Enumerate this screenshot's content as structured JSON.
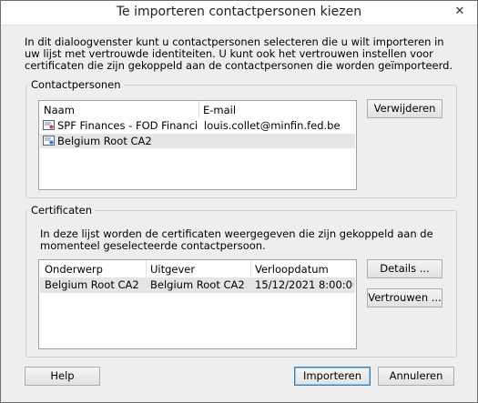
{
  "window": {
    "title": "Te importeren contactpersonen kiezen",
    "close_glyph": "✕"
  },
  "intro": "In dit dialoogvenster kunt u contactpersonen selecteren die u wilt importeren in uw lijst met vertrouwde identiteiten. U kunt ook het vertrouwen instellen voor certificaten die zijn gekoppeld aan de contactpersonen die worden geïmporteerd.",
  "contacts": {
    "legend": "Contactpersonen",
    "columns": [
      "Naam",
      "E-mail"
    ],
    "rows": [
      {
        "name": "SPF Finances - FOD Financien <lo...",
        "email": "louis.collet@minfin.fed.be",
        "icon": "certificate-icon"
      },
      {
        "name": "Belgium Root CA2",
        "email": "",
        "icon": "certificate-icon"
      }
    ],
    "remove_label": "Verwijderen"
  },
  "certs": {
    "legend": "Certificaten",
    "description": "In deze lijst worden de certificaten weergegeven die zijn gekoppeld aan de momenteel geselecteerde contactpersoon.",
    "columns": [
      "Onderwerp",
      "Uitgever",
      "Verloopdatum"
    ],
    "rows": [
      {
        "subject": "Belgium Root CA2",
        "issuer": "Belgium Root CA2",
        "expires": "15/12/2021 8:00:00"
      }
    ],
    "details_label": "Details ...",
    "trust_label": "Vertrouwen ..."
  },
  "footer": {
    "help_label": "Help",
    "import_label": "Importeren",
    "cancel_label": "Annuleren"
  },
  "colors": {
    "dialog_bg": "#eeeeee",
    "selected_row": "#e5e5e5",
    "default_button_border": "#3c7fb1"
  }
}
